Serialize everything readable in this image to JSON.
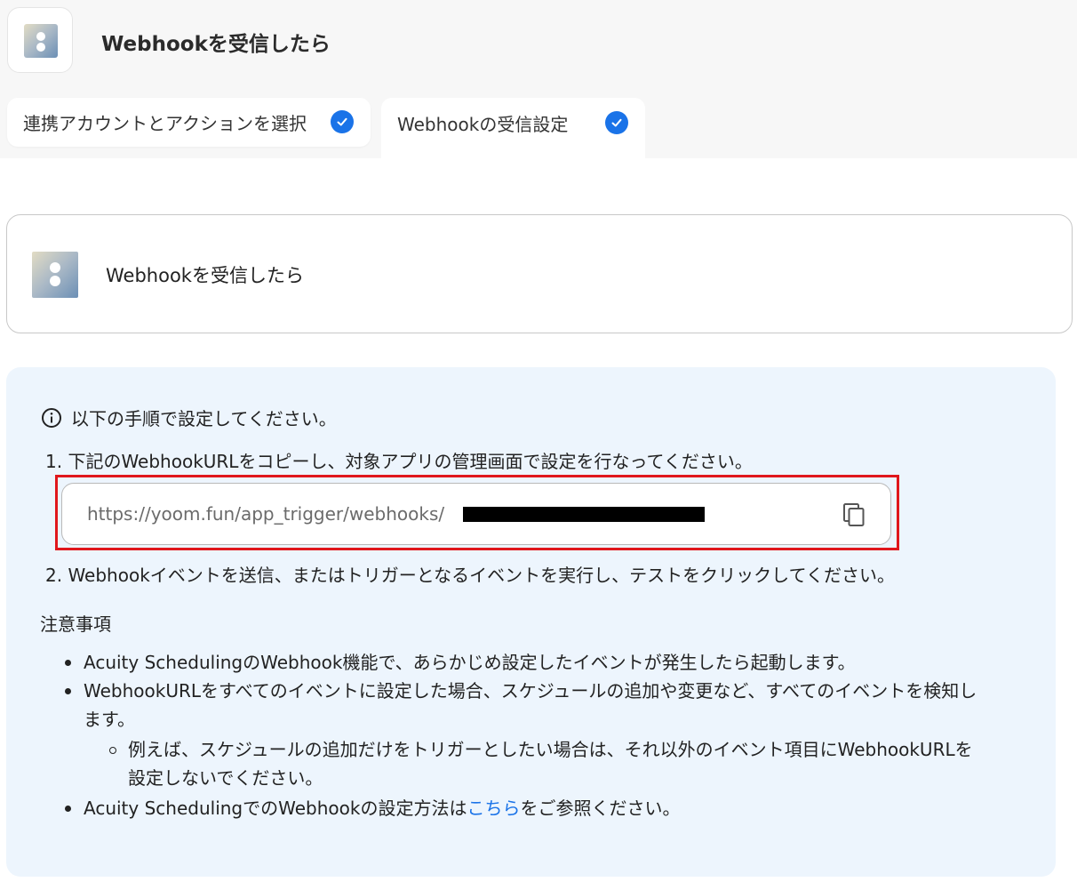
{
  "header": {
    "title": "Webhookを受信したら"
  },
  "tabs": [
    {
      "label": "連携アカウントとアクションを選択"
    },
    {
      "label": "Webhookの受信設定"
    }
  ],
  "trigger_card": {
    "title": "Webhookを受信したら"
  },
  "instructions": {
    "heading": "以下の手順で設定してください。",
    "step1": "1. 下記のWebhookURLをコピーし、対象アプリの管理画面で設定を行なってください。",
    "webhook_url": "https://yoom.fun/app_trigger/webhooks/",
    "step2": "2. Webhookイベントを送信、またはトリガーとなるイベントを実行し、テストをクリックしてください。"
  },
  "notes": {
    "title": "注意事項",
    "item1": "Acuity SchedulingのWebhook機能で、あらかじめ設定したイベントが発生したら起動します。",
    "item2_line1": "WebhookURLをすべてのイベントに設定した場合、スケジュールの追加や変更など、すべてのイベントを検知し",
    "item2_line2": "ます。",
    "subitem_line1": "例えば、スケジュールの追加だけをトリガーとしたい場合は、それ以外のイベント項目にWebhookURLを",
    "subitem_line2": "設定しないでください。",
    "item3_prefix": "Acuity SchedulingでのWebhookの設定方法は",
    "item3_link": "こちら",
    "item3_suffix": "をご参照ください。"
  },
  "colors": {
    "accent": "#1a73e8",
    "highlight_border": "#e0171c",
    "info_panel_bg": "#edf5fd"
  }
}
